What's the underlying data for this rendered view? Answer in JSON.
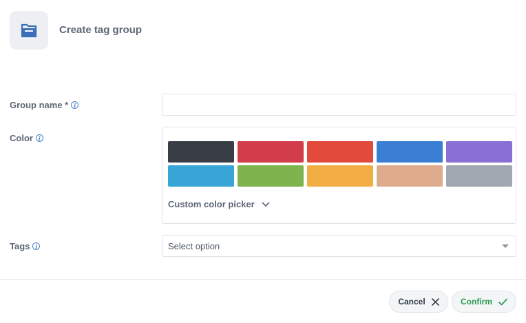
{
  "header": {
    "title": "Create tag group",
    "icon": "folder-icon",
    "icon_color": "#3a6fb8"
  },
  "form": {
    "group_name": {
      "label": "Group name *",
      "value": "",
      "placeholder": ""
    },
    "color": {
      "label": "Color",
      "swatches": [
        {
          "name": "charcoal",
          "hex": "#383d46"
        },
        {
          "name": "red",
          "hex": "#d23c4b"
        },
        {
          "name": "orange-red",
          "hex": "#e24a3b"
        },
        {
          "name": "blue",
          "hex": "#3b7fd4"
        },
        {
          "name": "purple",
          "hex": "#8a6fd4"
        },
        {
          "name": "sky-blue",
          "hex": "#37a5d5"
        },
        {
          "name": "green",
          "hex": "#7fb34e"
        },
        {
          "name": "amber",
          "hex": "#f2ae45"
        },
        {
          "name": "tan",
          "hex": "#deac8d"
        },
        {
          "name": "gray",
          "hex": "#a1a7b0"
        }
      ],
      "custom_picker_label": "Custom color picker"
    },
    "tags": {
      "label": "Tags",
      "selected": "Select option"
    }
  },
  "footer": {
    "cancel_label": "Cancel",
    "confirm_label": "Confirm",
    "confirm_color": "#2e9a52"
  }
}
